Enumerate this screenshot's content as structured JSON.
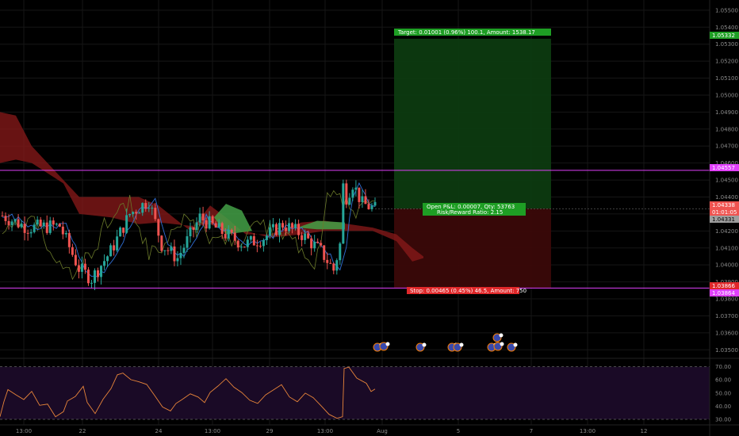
{
  "price_axis": {
    "ticks": [
      "1.05500",
      "1.05400",
      "1.05300",
      "1.05200",
      "1.05100",
      "1.05000",
      "1.04900",
      "1.04800",
      "1.04700",
      "1.04600",
      "1.04500",
      "1.04400",
      "1.04300",
      "1.04200",
      "1.04100",
      "1.04000",
      "1.03900",
      "1.03800",
      "1.03700",
      "1.03600",
      "1.03500"
    ],
    "tags": {
      "target": "1.05332",
      "upper_line": "1.04557",
      "last_price": "1.04338",
      "countdown": "01:01:05",
      "entry": "1.04331",
      "stop": "1.03866",
      "lower_line": "1.03864"
    }
  },
  "rsi_axis": {
    "ticks": [
      "70.00",
      "60.00",
      "50.00",
      "40.00",
      "30.00"
    ]
  },
  "time_axis": {
    "labels": [
      "13:00",
      "22",
      "24",
      "13:00",
      "29",
      "13:00",
      "Aug",
      "5",
      "7",
      "13:00",
      "12"
    ]
  },
  "position": {
    "target_label": "Target: 0.01001 (0.96%) 100.1, Amount: 1538.17",
    "stop_label": "Stop: 0.00465 (0.45%) 46.5, Amount: 750",
    "pnl_label": "Open P&L: 0.00007, Qty: 53763",
    "rr_label": "Risk/Reward Ratio: 2.15"
  },
  "colors": {
    "background": "#000000",
    "up_candle": "#26a69a",
    "down_candle": "#ef5350",
    "horizontal_line": "#e040fb",
    "profit_zone": "#0d3a10",
    "loss_zone": "#3a0808",
    "kumo_bear": "#8b1a1a",
    "kumo_bull": "#43a047",
    "rsi_line": "#e8853a",
    "rsi_band": "#1a0a26"
  },
  "chart_data": {
    "type": "candlestick",
    "price_range": [
      1.0345,
      1.0556
    ],
    "rsi_range": [
      27,
      74
    ],
    "horizontal_lines": [
      1.04557,
      1.03864
    ],
    "long_position": {
      "entry": 1.04331,
      "target": 1.05332,
      "stop": 1.03866
    },
    "events_icons": 7
  }
}
